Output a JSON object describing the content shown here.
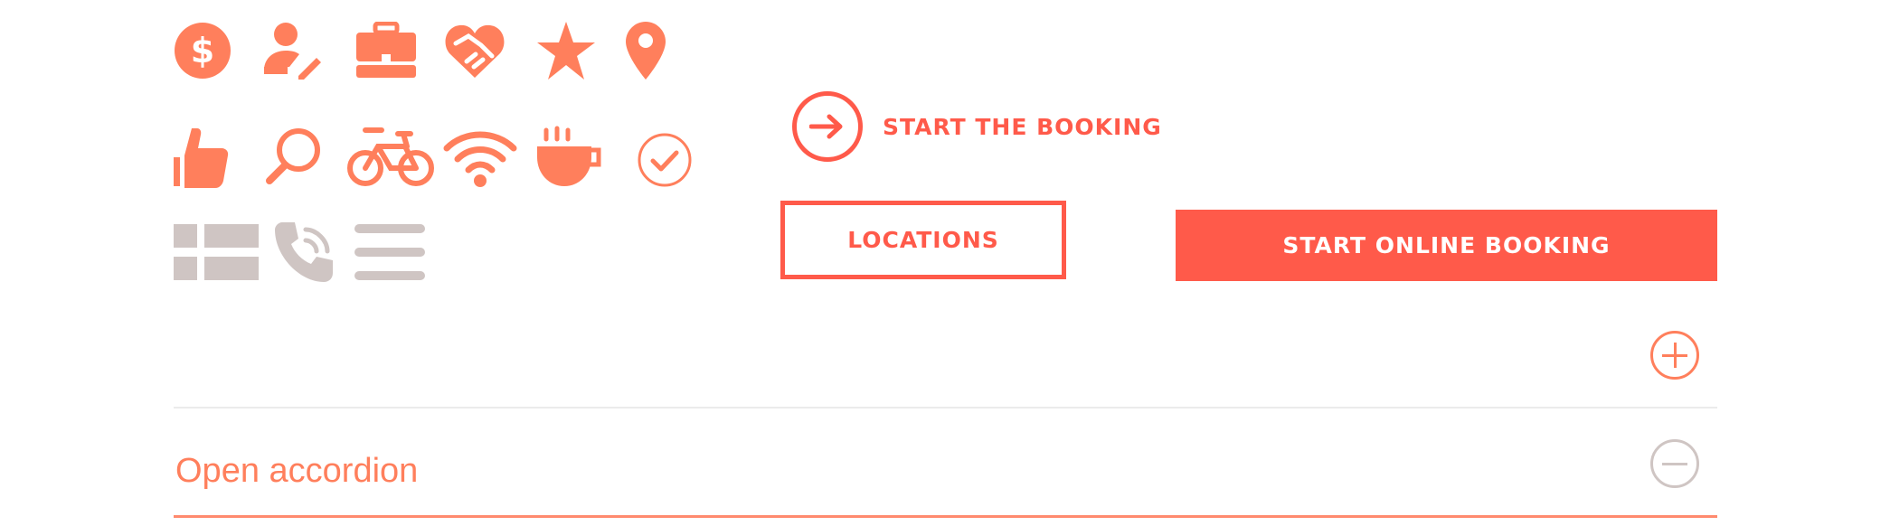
{
  "colors": {
    "accent": "#ff5a4a",
    "icon": "#ff7f5c",
    "muted_icon": "#cfc5c3",
    "divider": "#ebebeb"
  },
  "icons": [
    "dollar-circle-icon",
    "user-edit-icon",
    "briefcase-icon",
    "handshake-heart-icon",
    "star-icon",
    "map-pin-icon",
    "thumbs-up-icon",
    "search-icon",
    "bicycle-icon",
    "wifi-icon",
    "coffee-cup-icon",
    "check-circle-icon",
    "grid-view-icon",
    "phone-call-icon",
    "list-view-icon"
  ],
  "booking_link": {
    "label": "START THE BOOKING",
    "icon": "arrow-right-icon"
  },
  "locations_button": {
    "label": "LOCATIONS"
  },
  "online_booking_button": {
    "label": "START ONLINE BOOKING"
  },
  "accordion": {
    "items": [
      {
        "title": "",
        "state": "collapsed",
        "toggle_icon": "plus-circle-icon"
      },
      {
        "title": "Open accordion",
        "state": "expanded",
        "toggle_icon": "minus-circle-icon"
      }
    ]
  }
}
